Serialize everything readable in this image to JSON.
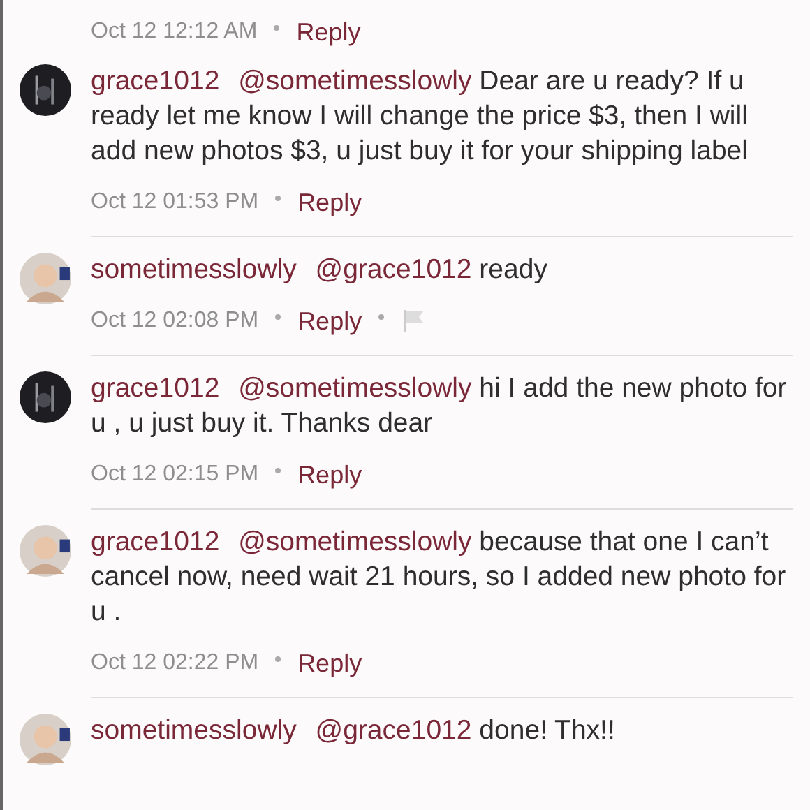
{
  "comments": [
    {
      "time": "Oct 12 12:12 AM",
      "reply": "Reply",
      "flag": false
    },
    {
      "user": "grace1012",
      "mention": "@sometimesslowly",
      "text": "Dear are u ready? If u ready let me know I will change the price $3, then I will add new photos $3, u just buy it for your shipping label",
      "time": "Oct 12 01:53 PM",
      "reply": "Reply",
      "flag": false
    },
    {
      "user": "sometimesslowly",
      "mention": "@grace1012",
      "text": "ready",
      "time": "Oct 12 02:08 PM",
      "reply": "Reply",
      "flag": true
    },
    {
      "user": "grace1012",
      "mention": "@sometimesslowly",
      "text": "hi I add the new photo for u , u just buy it. Thanks dear",
      "time": "Oct 12 02:15 PM",
      "reply": "Reply",
      "flag": false
    },
    {
      "user": "grace1012",
      "mention": "@sometimesslowly",
      "text": "because that one I can’t cancel now, need wait 21 hours, so I added new photo for u .",
      "time": "Oct 12 02:22 PM",
      "reply": "Reply",
      "flag": false
    },
    {
      "user": "sometimesslowly",
      "mention": "@grace1012",
      "text": "done! Thx!!"
    }
  ]
}
